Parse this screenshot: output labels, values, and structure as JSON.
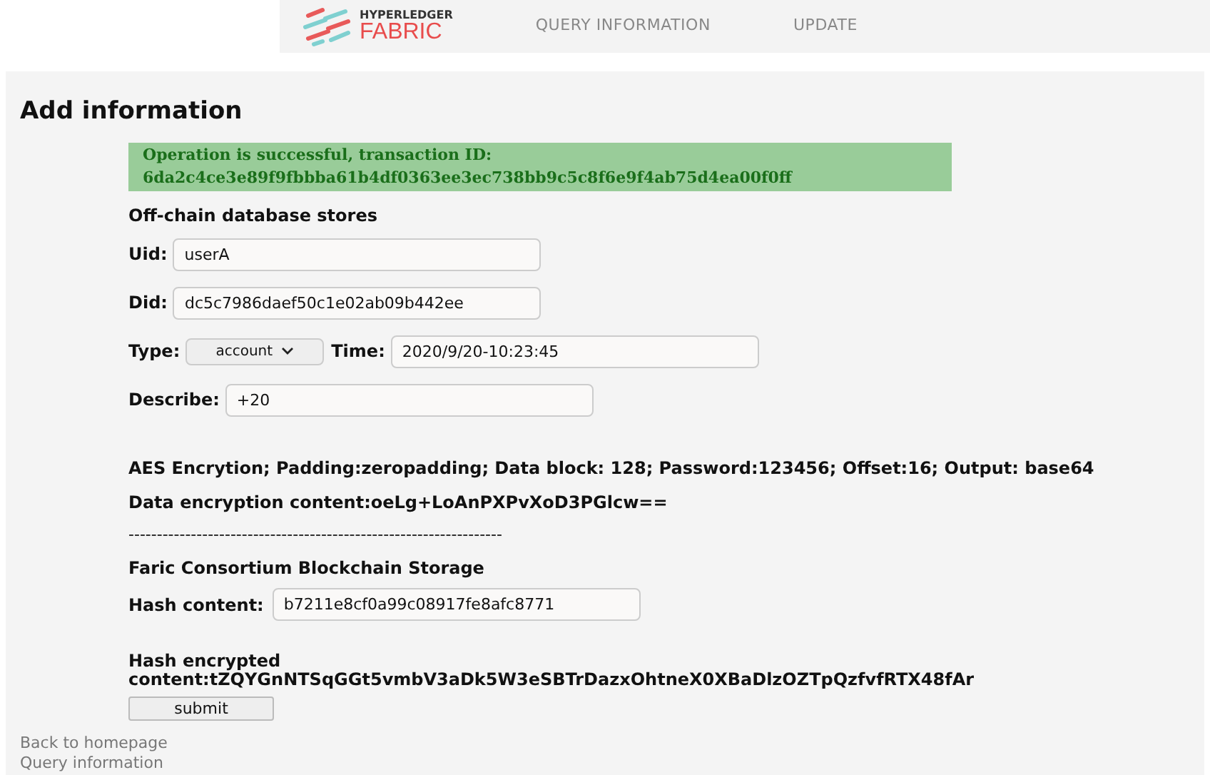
{
  "nav": {
    "logo_top": "HYPERLEDGER",
    "logo_bottom": "FABRIC",
    "links": [
      {
        "label": "QUERY INFORMATION"
      },
      {
        "label": "UPDATE"
      }
    ]
  },
  "heading": "Add information",
  "alert": {
    "lines": [
      "Operation is successful, transaction ID:",
      "6da2c4ce3e89f9fbbba61b4df0363ee3ec738bb9c5c8f6e9f4ab75d4ea00f0ff"
    ]
  },
  "section_title": "Off-chain database stores",
  "form_rows": [
    [
      {
        "kind": "input",
        "label": "Uid:",
        "value": "userA"
      }
    ],
    [
      {
        "kind": "input",
        "label": "Did:",
        "value": "dc5c7986daef50c1e02ab09b442ee"
      }
    ],
    [
      {
        "kind": "select",
        "label": "Type:",
        "value": "account"
      },
      {
        "kind": "input",
        "label": "Time:",
        "value": "2020/9/20-10:23:45"
      }
    ],
    [
      {
        "kind": "input",
        "label": "Describe:",
        "value": "+20"
      }
    ]
  ],
  "aes_info": "AES Encrytion; Padding:zeropadding; Data block: 128; Password:123456; Offset:16; Output: base64",
  "data_encryption": "Data encryption content:oeLg+LoAnPXPvXoD3PGlcw==",
  "separator": "------------------------------------------------------------------",
  "chain_title": "Faric Consortium Blockchain Storage",
  "hash_field": {
    "label": "Hash content:",
    "value": "b7211e8cf0a99c08917fe8afc8771"
  },
  "hash_encrypted": [
    "Hash encrypted",
    "content:tZQYGnNTSqGGt5vmbV3aDk5W3eSBTrDazxOhtneX0XBaDlzOZTpQzfvfRTX48fAr"
  ],
  "submit": "submit",
  "footer_links": [
    "Back to homepage",
    "Query information"
  ]
}
